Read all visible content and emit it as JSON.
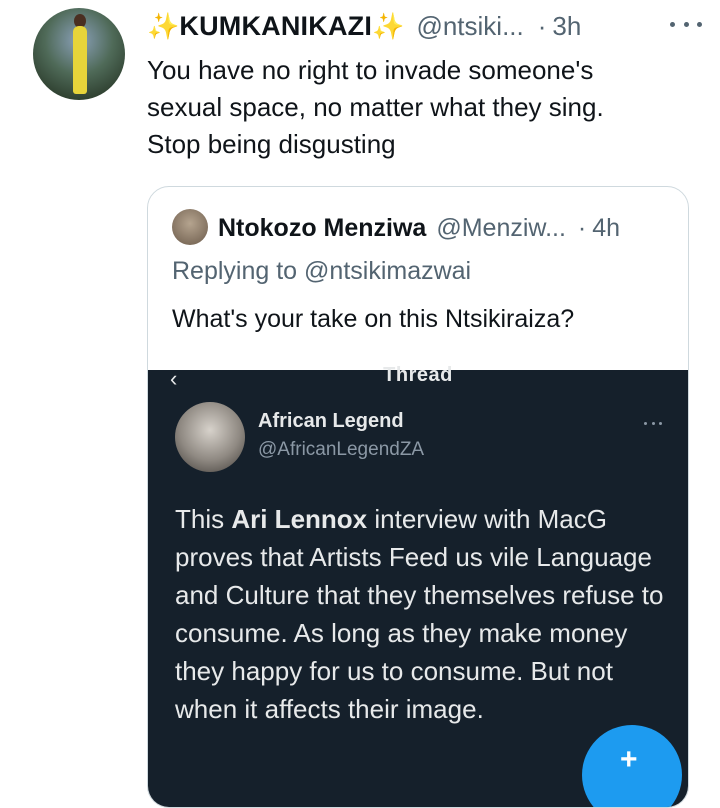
{
  "tweet": {
    "display_name": "KUMKANIKAZI",
    "handle": "@ntsiki...",
    "dot": "·",
    "time": "3h",
    "text": "You have no right to invade someone's\nsexual space, no matter what they sing.\nStop being disgusting"
  },
  "quote": {
    "display_name": "Ntokozo Menziwa",
    "handle": "@Menziw...",
    "dot": "·",
    "time": "4h",
    "replying_prefix": "Replying to",
    "replying_handle": "@ntsikimazwai",
    "text": "What's your take on this Ntsikiraiza?"
  },
  "embedded_screenshot": {
    "header_label": "Thread",
    "back_glyph": "‹",
    "name": "African Legend",
    "handle": "@AfricanLegendZA",
    "body_prefix": "This ",
    "body_bold": "Ari Lennox",
    "body_rest": " interview with MacG proves that Artists Feed us vile Language and Culture that they themselves refuse to consume.  As long as they make money they happy for us to consume. But not when it affects their image.",
    "compose_glyph": "+"
  },
  "icons": {
    "sparkle": "✨"
  },
  "colors": {
    "secondary_text": "#536471",
    "accent_blue": "#1d9bf0",
    "dark_bg": "#15202b"
  }
}
